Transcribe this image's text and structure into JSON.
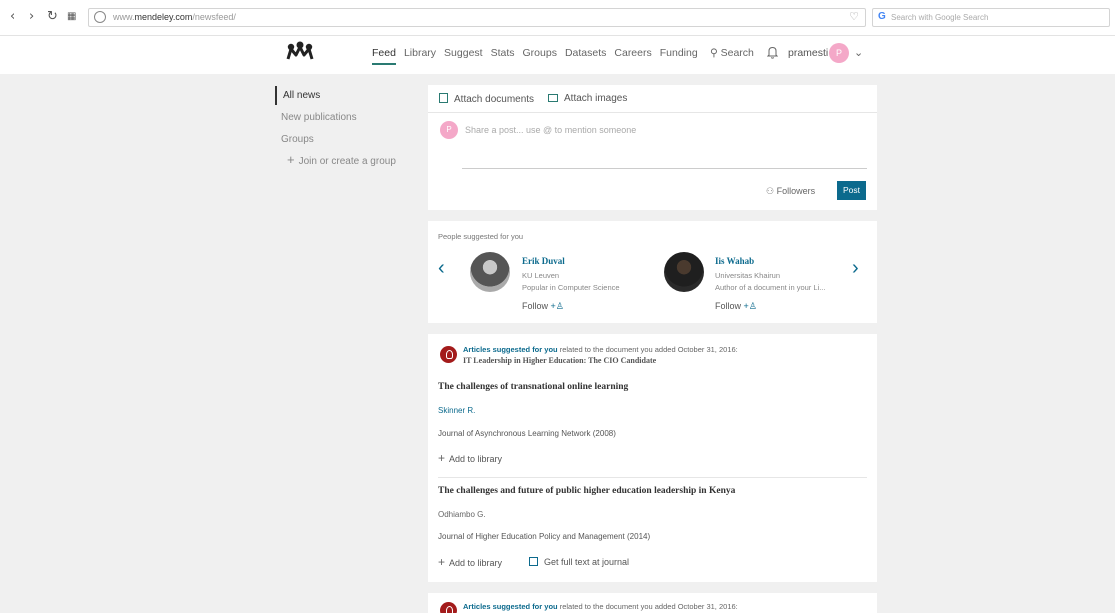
{
  "browser": {
    "url_prefix": "www.",
    "url_domain": "mendeley.com",
    "url_path": "/newsfeed/",
    "search_placeholder": "Search with Google Search"
  },
  "nav": {
    "items": [
      "Feed",
      "Library",
      "Suggest",
      "Stats",
      "Groups",
      "Datasets",
      "Careers",
      "Funding"
    ],
    "search": "Search",
    "user": "pramesti",
    "avatar_initial": "P",
    "accent_color": "#2a7a72"
  },
  "sidebar": {
    "items": [
      "All news",
      "New publications",
      "Groups"
    ],
    "join": "Join or create a group"
  },
  "post": {
    "attach_documents": "Attach documents",
    "attach_images": "Attach images",
    "avatar_initial": "P",
    "placeholder": "Share a post... use @ to mention someone",
    "followers": "Followers",
    "post_button": "Post"
  },
  "people": {
    "title": "People suggested for you",
    "persons": [
      {
        "name": "Erik Duval",
        "affiliation": "KU Leuven",
        "note": "Popular in Computer Science",
        "follow": "Follow"
      },
      {
        "name": "Iis Wahab",
        "affiliation": "Universitas Khairun",
        "note": "Author of a document in your Li...",
        "follow": "Follow"
      }
    ]
  },
  "articles": {
    "suggested_label": "Articles suggested for you",
    "suggested_text": "related to the document you added October 31, 2016:",
    "doc_title": "IT Leadership in Higher Education: The CIO Candidate",
    "items": [
      {
        "title": "The challenges of transnational online learning",
        "author": "Skinner R.",
        "journal": "Journal of Asynchronous Learning Network (2008)",
        "add": "Add to library"
      },
      {
        "title": "The challenges and future of public higher education leadership in Kenya",
        "author": "Odhiambo G.",
        "journal": "Journal of Higher Education Policy and Management (2014)",
        "add": "Add to library",
        "fulltext": "Get full text at journal"
      }
    ]
  },
  "articles2": {
    "suggested_label": "Articles suggested for you",
    "suggested_text": "related to the document you added October 31, 2016:"
  }
}
